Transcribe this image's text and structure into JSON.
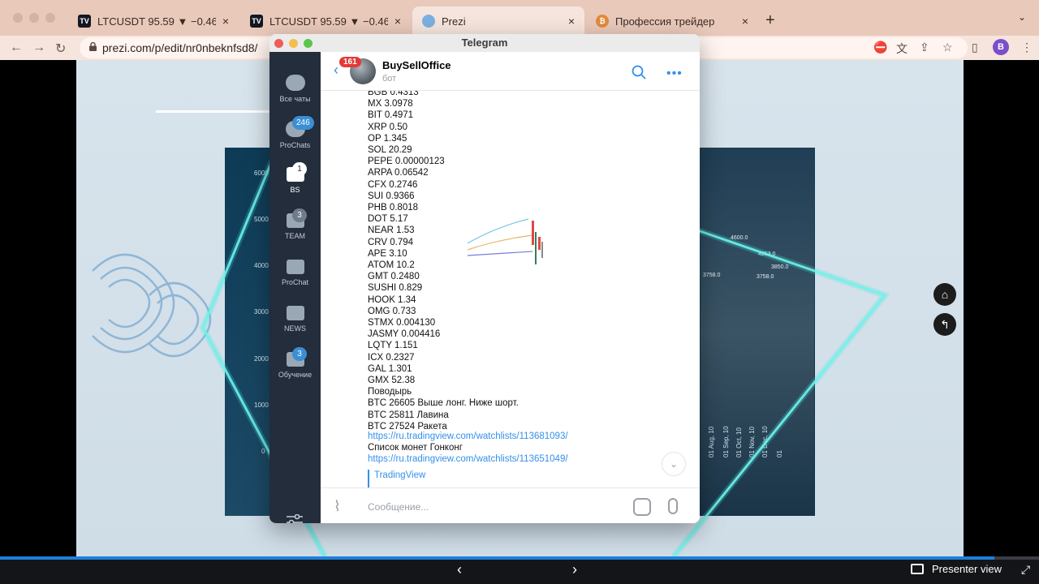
{
  "browser": {
    "tabs": [
      {
        "label": "LTCUSDT 95.59 ▼ −0.46% My",
        "icon": "tradingview-icon",
        "close": "×"
      },
      {
        "label": "LTCUSDT 95.59 ▼ −0.46% My",
        "icon": "tradingview-icon",
        "close": "×"
      },
      {
        "label": "Prezi",
        "icon": "prezi-icon",
        "close": "×"
      },
      {
        "label": "Профессия трейдер",
        "icon": "bitcoin-icon",
        "close": "×"
      }
    ],
    "new_tab": "+",
    "url": "prezi.com/p/edit/nr0nbeknfsd8/",
    "profile_initial": "B"
  },
  "slide": {
    "y_ticks": [
      "6000",
      "5000",
      "4000",
      "3000",
      "2000",
      "1000",
      "0"
    ],
    "x_ticks": [
      "01 Aug, 10",
      "01 Sep, 10",
      "01 Oct, 10",
      "01 Nov, 10",
      "01 Dec, 10",
      "01"
    ],
    "right_labels": [
      "4600.0",
      "4253.0",
      "3850.0",
      "3758.0",
      "3758.0"
    ]
  },
  "telegram": {
    "window_title": "Telegram",
    "sidebar": [
      {
        "label": "Все чаты",
        "badge": ""
      },
      {
        "label": "ProChats",
        "badge": "246"
      },
      {
        "label": "BS",
        "badge": "1"
      },
      {
        "label": "TEAM",
        "badge": "3"
      },
      {
        "label": "ProChat",
        "badge": ""
      },
      {
        "label": "NEWS",
        "badge": ""
      },
      {
        "label": "Обучение",
        "badge": "3"
      }
    ],
    "header": {
      "unread_badge": "161",
      "name": "BuySellOffice",
      "subtitle": "бот"
    },
    "messages": [
      "BGB 0.4313",
      "MX 3.0978",
      "BIT 0.4971",
      "XRP 0.50",
      "OP 1.345",
      "SOL 20.29",
      "PEPE 0.00000123",
      "ARPA 0.06542",
      "CFX 0.2746",
      "SUI 0.9366",
      "PHB 0.8018",
      "DOT 5.17",
      "NEAR 1.53",
      "CRV 0.794",
      "APE 3.10",
      "ATOM 10.2",
      "GMT 0.2480",
      "SUSHI 0.829",
      "HOOK 1.34",
      "OMG 0.733",
      "STMX 0.004130",
      "JASMY 0.004416",
      "LQTY 1.151",
      "ICX 0.2327",
      "GAL 1.301",
      "GMX 52.38",
      "Поводырь",
      "BTC 26605 Выше лонг. Ниже шорт.",
      "BTC 25811 Лавина",
      "BTC 27524 Ракета"
    ],
    "link1": "https://ru.tradingview.com/watchlists/113681093/",
    "list_label": "Список монет Гонконг",
    "link2": "https://ru.tradingview.com/watchlists/113651049/",
    "preview_title": "TradingView",
    "input_placeholder": "Сообщение..."
  },
  "presenter": {
    "label": "Presenter view"
  }
}
